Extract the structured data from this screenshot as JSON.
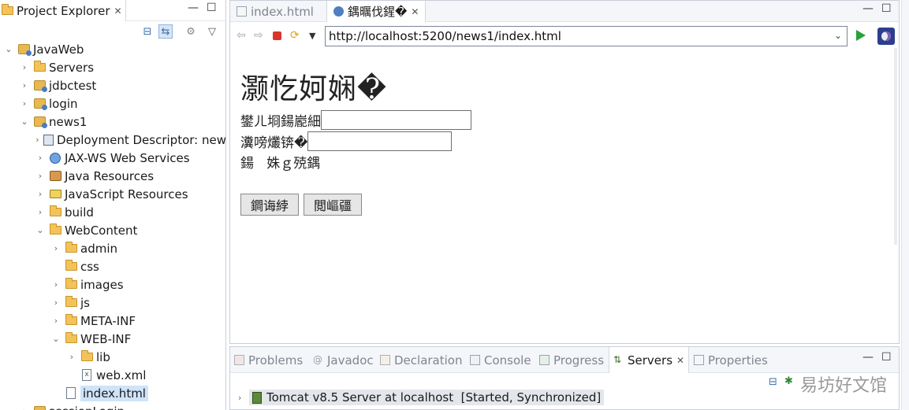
{
  "project_explorer": {
    "tab_label": "Project Explorer",
    "tree": [
      {
        "label": "JavaWeb",
        "icon": "project-icon",
        "chevron": "⌄"
      },
      {
        "label": "Servers",
        "icon": "folder-icon",
        "chevron": "›"
      },
      {
        "label": "jdbctest",
        "icon": "web-project-icon",
        "chevron": "›"
      },
      {
        "label": "login",
        "icon": "web-project-icon",
        "chevron": "›"
      },
      {
        "label": "news1",
        "icon": "web-project-icon",
        "chevron": "⌄"
      },
      {
        "label": "Deployment Descriptor: new",
        "icon": "descriptor-icon",
        "chevron": "›"
      },
      {
        "label": "JAX-WS Web Services",
        "icon": "webservice-icon",
        "chevron": "›"
      },
      {
        "label": "Java Resources",
        "icon": "java-resources-icon",
        "chevron": "›"
      },
      {
        "label": "JavaScript Resources",
        "icon": "js-resources-icon",
        "chevron": "›"
      },
      {
        "label": "build",
        "icon": "folder-icon",
        "chevron": "›"
      },
      {
        "label": "WebContent",
        "icon": "folder-icon",
        "chevron": "⌄"
      },
      {
        "label": "admin",
        "icon": "folder-icon",
        "chevron": "›"
      },
      {
        "label": "css",
        "icon": "folder-icon",
        "chevron": ""
      },
      {
        "label": "images",
        "icon": "folder-icon",
        "chevron": "›"
      },
      {
        "label": "js",
        "icon": "folder-icon",
        "chevron": "›"
      },
      {
        "label": "META-INF",
        "icon": "folder-icon",
        "chevron": "›"
      },
      {
        "label": "WEB-INF",
        "icon": "folder-icon",
        "chevron": "⌄"
      },
      {
        "label": "lib",
        "icon": "folder-icon",
        "chevron": "›"
      },
      {
        "label": "web.xml",
        "icon": "xml-file-icon",
        "chevron": ""
      },
      {
        "label": "index.html",
        "icon": "html-file-icon",
        "chevron": ""
      },
      {
        "label": "sessionLogin",
        "icon": "web-project-icon",
        "chevron": "›"
      }
    ]
  },
  "editor": {
    "tabs": [
      {
        "label": "index.html",
        "active": false
      },
      {
        "label": "鍝曞伐鍟�",
        "active": true
      }
    ],
    "url": "http://localhost:5200/news1/index.html",
    "page": {
      "heading": "灏忔妸娴�",
      "username_label": "鐢ㄦ埛鍚嶏細",
      "password_label": "瀵嗙爜锛�",
      "remember_label": "鍚   姝ｇ殑鍝",
      "submit_button": "鐧诲綍",
      "reset_button": "閲嶇疆"
    }
  },
  "bottom_panel": {
    "tabs": [
      {
        "label": "Problems",
        "active": false
      },
      {
        "label": "Javadoc",
        "active": false
      },
      {
        "label": "Declaration",
        "active": false
      },
      {
        "label": "Console",
        "active": false
      },
      {
        "label": "Progress",
        "active": false
      },
      {
        "label": "Servers",
        "active": true
      },
      {
        "label": "Properties",
        "active": false
      }
    ],
    "server_entry": "Tomcat v8.5 Server at localhost  [Started, Synchronized]"
  },
  "watermark": "易坊好文馆",
  "colors": {
    "selection": "#cfe3fa",
    "go_green": "#26a23a",
    "stop_red": "#d9352a"
  }
}
